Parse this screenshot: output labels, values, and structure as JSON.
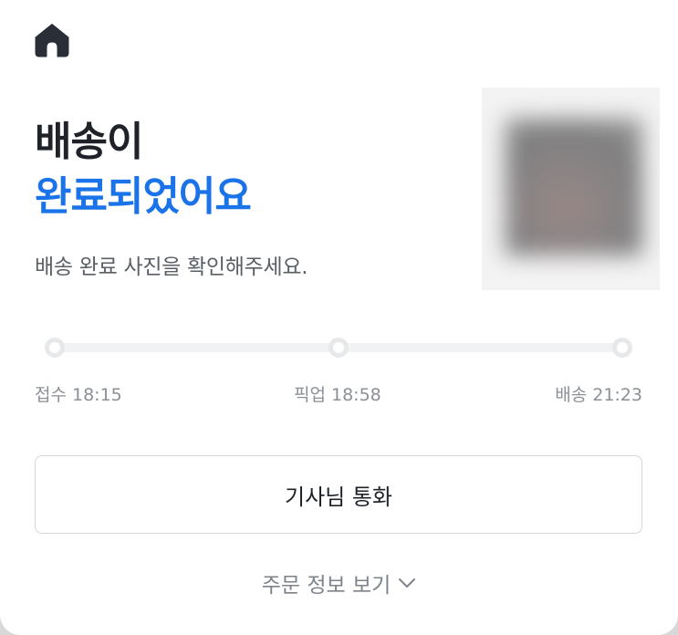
{
  "header": {
    "home_icon": "home-icon"
  },
  "status": {
    "title_line1": "배송이",
    "title_line2": "완료되었어요",
    "subtitle": "배송 완료 사진을 확인해주세요.",
    "accent_color": "#1a73e8"
  },
  "photo": {
    "kind": "delivery-photo-thumbnail (blurred)"
  },
  "timeline": {
    "steps": [
      {
        "label": "접수 18:15"
      },
      {
        "label": "픽업 18:58"
      },
      {
        "label": "배송 21:23"
      }
    ]
  },
  "actions": {
    "call_driver_label": "기사님 통화",
    "order_info_label": "주문 정보 보기",
    "order_info_icon": "chevron-down-icon"
  }
}
